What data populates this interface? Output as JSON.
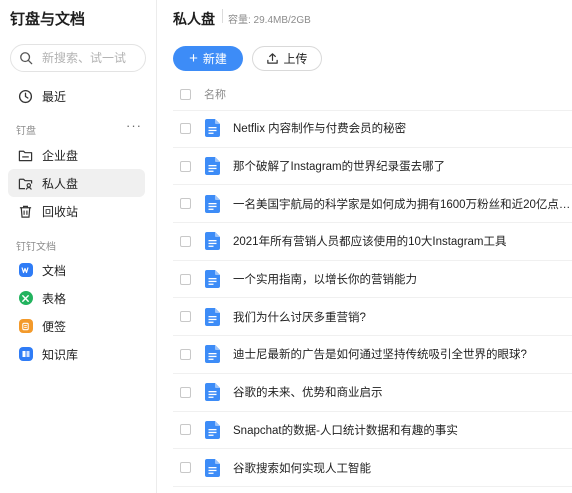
{
  "sidebar": {
    "title": "钉盘与文档",
    "search": {
      "placeholder": "新搜索、试一试",
      "value": ""
    },
    "recent": {
      "label": "最近",
      "icon": "clock-icon"
    },
    "section_dingpan": {
      "label": "钉盘",
      "more": "···"
    },
    "dingpan_items": [
      {
        "label": "企业盘",
        "icon": "folder-icon"
      },
      {
        "label": "私人盘",
        "icon": "folder-user-icon",
        "active": true
      },
      {
        "label": "回收站",
        "icon": "trash-icon"
      }
    ],
    "section_docs": {
      "label": "钉钉文档"
    },
    "doc_items": [
      {
        "label": "文档",
        "icon": "doc-app-icon",
        "color": "#2f7cf6"
      },
      {
        "label": "表格",
        "icon": "sheet-app-icon",
        "color": "#22b35e"
      },
      {
        "label": "便签",
        "icon": "note-app-icon",
        "color": "#f39a2b"
      },
      {
        "label": "知识库",
        "icon": "knowledge-app-icon",
        "color": "#2f7cf6"
      }
    ]
  },
  "main": {
    "title": "私人盘",
    "capacity": "容量: 29.4MB/2GB",
    "new_button": "新建",
    "upload_button": "上传",
    "column_name": "名称",
    "accent_color": "#3d8cf7",
    "files": [
      "Netflix 内容制作与付费会员的秘密",
      "那个破解了Instagram的世界纪录蛋去哪了",
      "一名美国宇航局的科学家是如何成为拥有1600万粉丝和近20亿点击…",
      "2021年所有营销人员都应该使用的10大Instagram工具",
      "一个实用指南，以增长你的营销能力",
      "我们为什么讨厌多重营销?",
      "迪士尼最新的广告是如何通过坚持传统吸引全世界的眼球?",
      "谷歌的未来、优势和商业启示",
      "Snapchat的数据-人口统计数据和有趣的事实",
      "谷歌搜索如何实现人工智能"
    ]
  }
}
